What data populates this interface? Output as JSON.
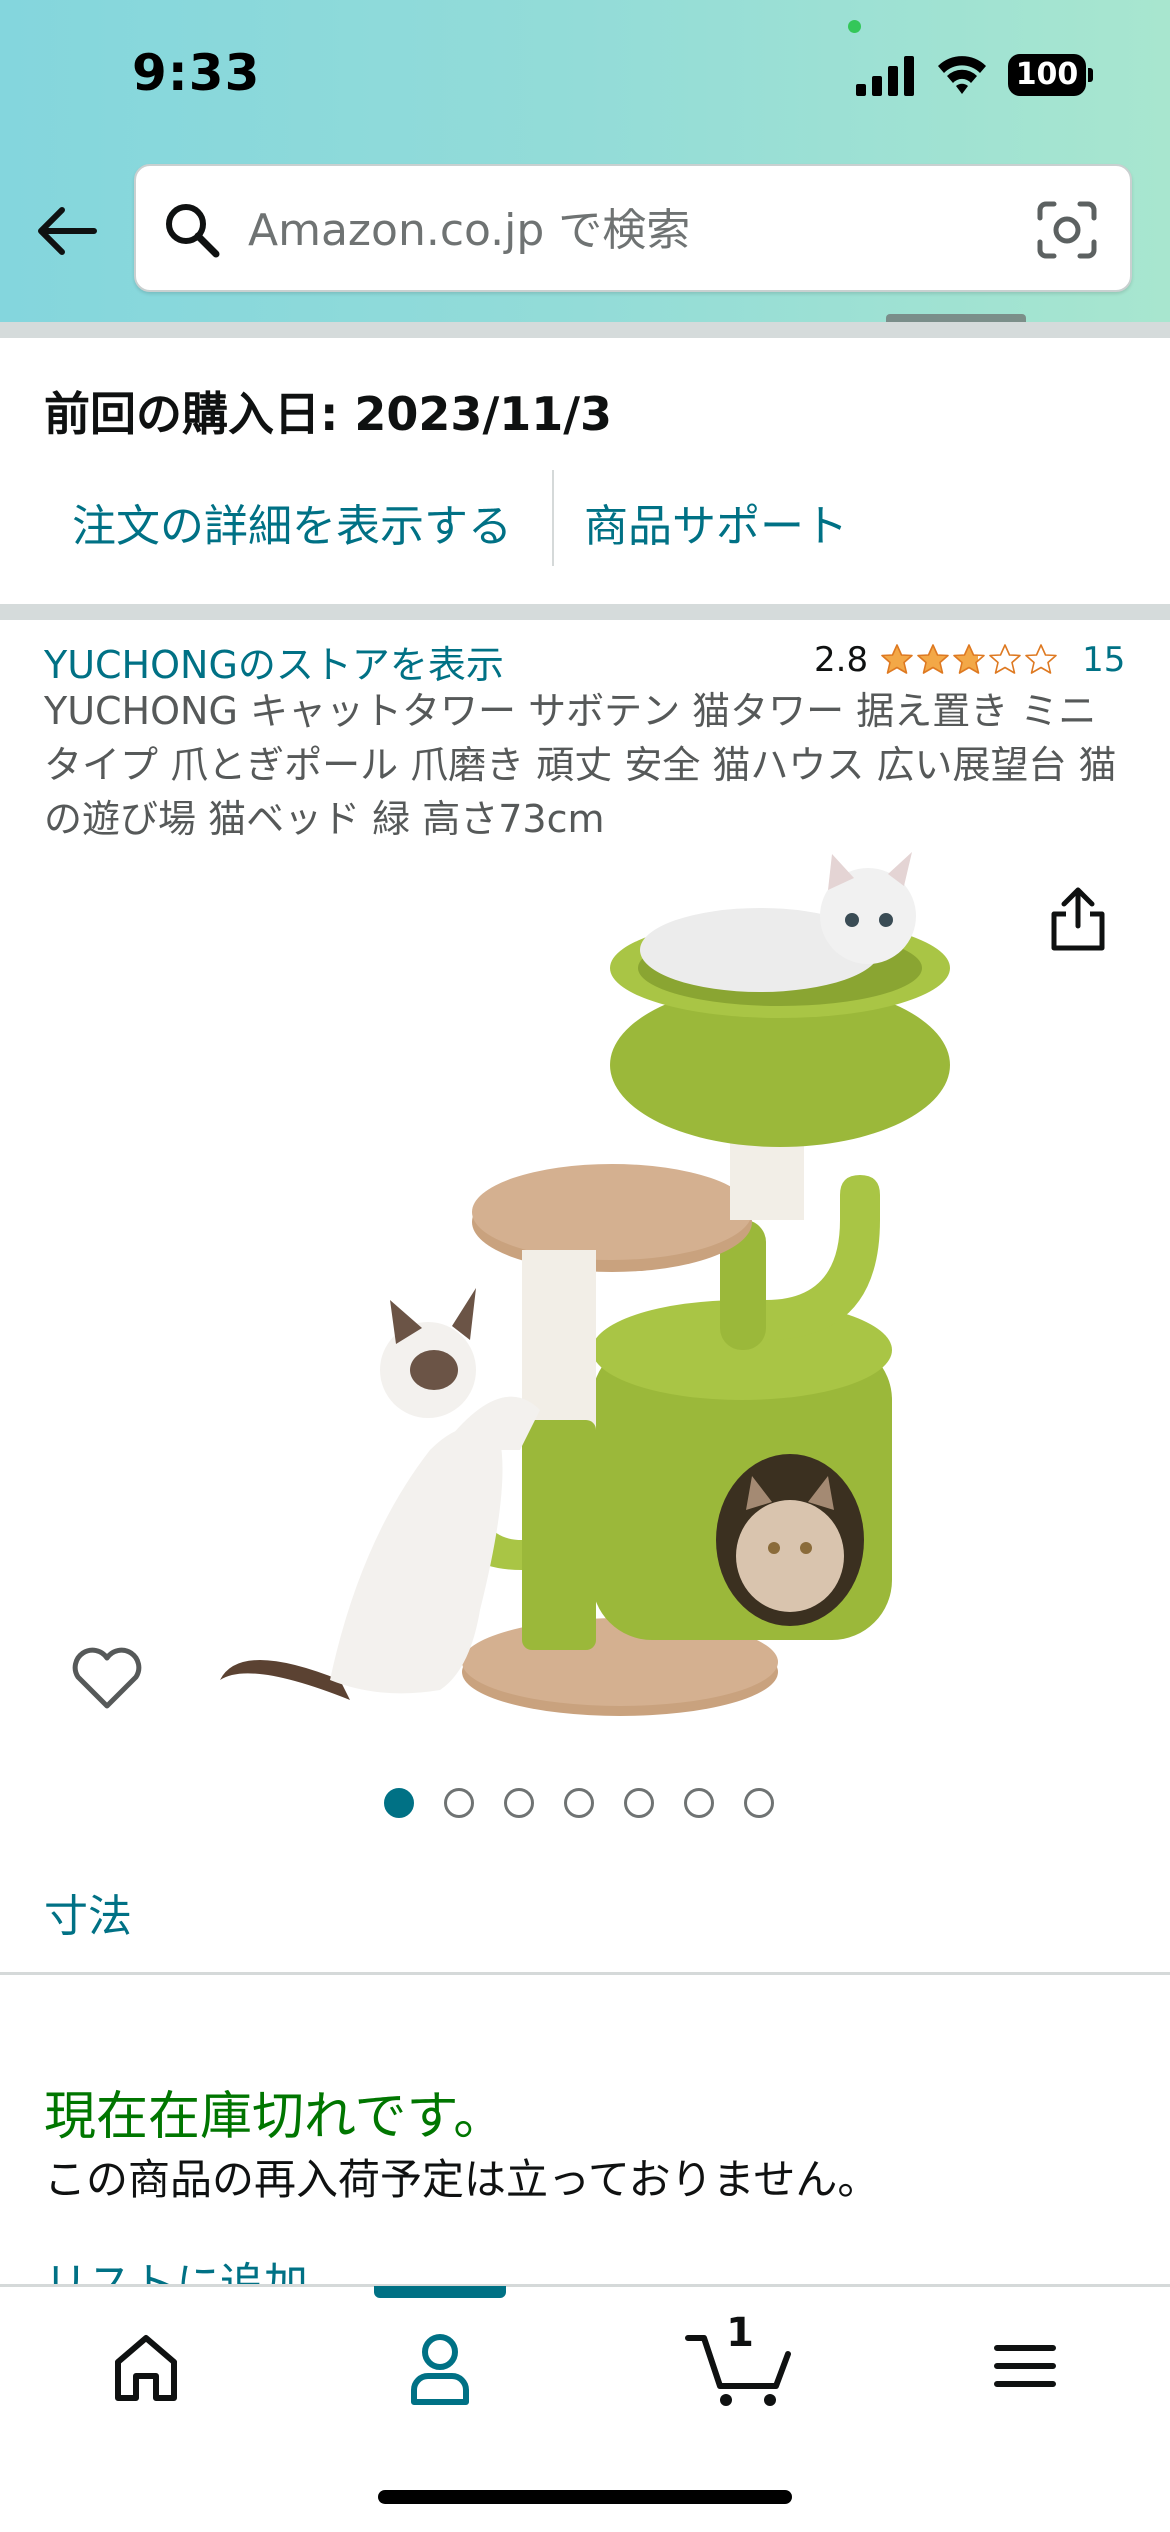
{
  "status_bar": {
    "time": "9:33",
    "battery": "100"
  },
  "search": {
    "placeholder": "Amazon.co.jp で検索"
  },
  "purchase": {
    "last_purchase": "前回の購入日: 2023/11/3",
    "order_details_link": "注文の詳細を表示する",
    "support_link": "商品サポート"
  },
  "product": {
    "store_link": "YUCHONGのストアを表示",
    "rating_value": "2.8",
    "rating_stars": 2.8,
    "rating_count": "15",
    "title": "YUCHONG キャットタワー サボテン 猫タワー 据え置き ミニタイプ 爪とぎポール 爪磨き 頑丈 安全 猫ハウス 広い展望台 猫の遊び場 猫ベッド 緑 高さ73cm",
    "image_count": 7,
    "active_image": 0,
    "dimensions_link": "寸法",
    "stock_status": "現在在庫切れです。",
    "restock_note": "この商品の再入荷予定は立っておりません。",
    "add_to_list": "リストに追加"
  },
  "bottom_nav": {
    "items": [
      "home-icon",
      "account-icon",
      "cart-icon",
      "menu-icon"
    ],
    "active": "account-icon",
    "cart_count": "1"
  },
  "colors": {
    "link": "#007185",
    "in_stock_green": "#007600",
    "star": "#f3a847",
    "header_gradient_start": "#84d6dd",
    "header_gradient_end": "#a8e6cf"
  }
}
